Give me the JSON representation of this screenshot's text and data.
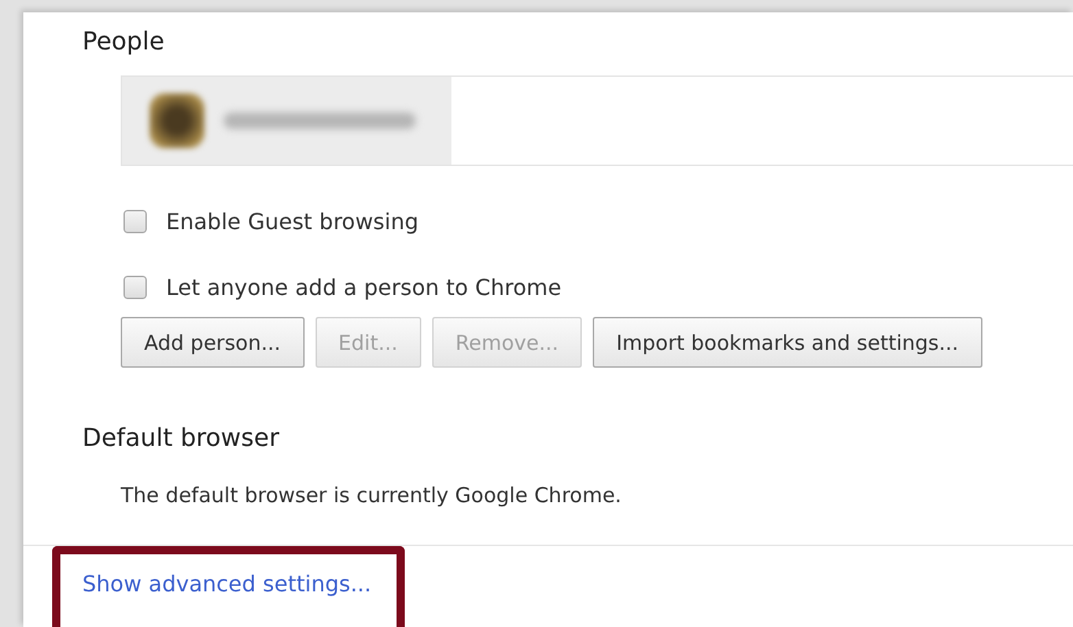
{
  "people": {
    "heading": "People",
    "options": [
      {
        "label": "Enable Guest browsing",
        "checked": false
      },
      {
        "label": "Let anyone add a person to Chrome",
        "checked": false
      }
    ],
    "buttons": [
      {
        "label": "Add person...",
        "disabled": false
      },
      {
        "label": "Edit...",
        "disabled": true
      },
      {
        "label": "Remove...",
        "disabled": true
      },
      {
        "label": "Import bookmarks and settings...",
        "disabled": false
      }
    ]
  },
  "default_browser": {
    "heading": "Default browser",
    "text": "The default browser is currently Google Chrome."
  },
  "advanced_link": {
    "label": "Show advanced settings...",
    "highlighted": true
  }
}
